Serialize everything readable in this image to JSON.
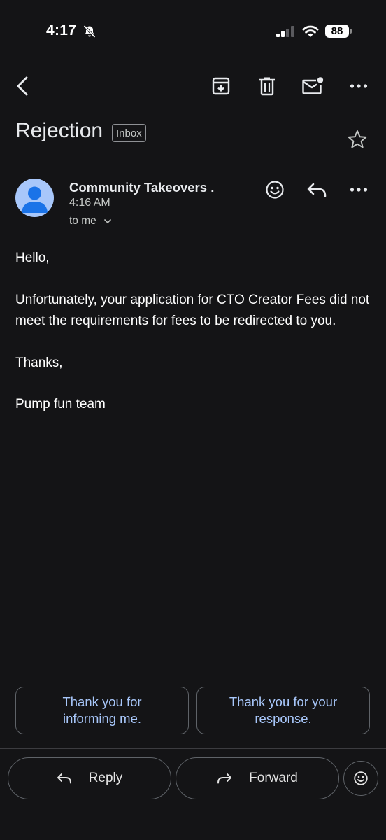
{
  "status_bar": {
    "time": "4:17",
    "battery": "88"
  },
  "icons": {
    "bell_muted": "bell-slash-icon",
    "signal": "cellular-signal-icon",
    "wifi": "wifi-icon",
    "back": "arrow-left-icon",
    "archive": "archive-icon",
    "trash": "trash-icon",
    "mail_unread": "mark-unread-icon",
    "more": "more-horizontal-icon",
    "star": "star-outline-icon",
    "emoji": "smile-icon",
    "reply": "reply-arrow-icon",
    "forward": "forward-arrow-icon",
    "chevron": "chevron-down-icon"
  },
  "email": {
    "subject": "Rejection",
    "label": "Inbox",
    "sender": "Community Takeovers .",
    "time": "4:16 AM",
    "recipient": "to me",
    "body": [
      "Hello,",
      "Unfortunately, your application for CTO Creator Fees did not meet the requirements for fees to be redirected to you.",
      "Thanks,",
      "Pump fun team"
    ]
  },
  "smart_replies": [
    "Thank you for informing me.",
    "Thank you for your response."
  ],
  "actions": {
    "reply": "Reply",
    "forward": "Forward"
  },
  "colors": {
    "background": "#141416",
    "accent": "#a8c7fa",
    "text": "#e8eaed",
    "border": "#5f6368"
  }
}
